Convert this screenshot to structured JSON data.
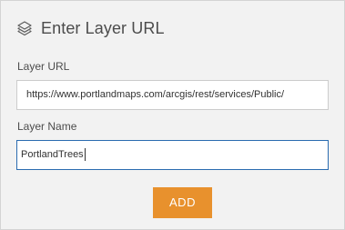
{
  "dialog": {
    "title": "Enter Layer URL",
    "title_icon": "layers-icon"
  },
  "form": {
    "url_label": "Layer URL",
    "url_value": "https://www.portlandmaps.com/arcgis/rest/services/Public/",
    "name_label": "Layer Name",
    "name_value": "PortlandTrees"
  },
  "actions": {
    "add_label": "ADD"
  },
  "colors": {
    "panel_background": "#f2f2f2",
    "accent_button": "#e8912d",
    "focus_border": "#2b6cb0"
  }
}
